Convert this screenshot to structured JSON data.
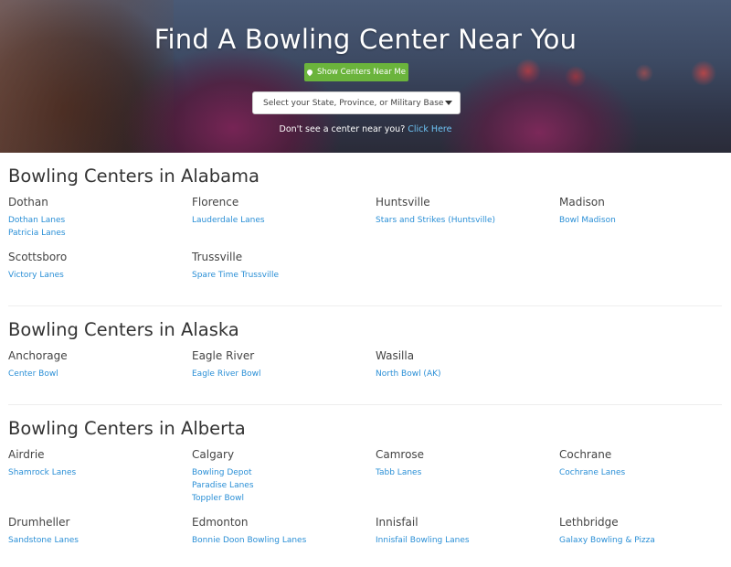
{
  "hero": {
    "title": "Find A Bowling Center Near You",
    "near_button": "Show Centers Near Me",
    "select_placeholder": "Select your State, Province, or Military Base",
    "note_text": "Don't see a center near you?",
    "note_link": "Click Here"
  },
  "sections": [
    {
      "title": "Bowling Centers in Alabama",
      "cities": [
        {
          "name": "Dothan",
          "centers": [
            "Dothan Lanes",
            "Patricia Lanes"
          ]
        },
        {
          "name": "Florence",
          "centers": [
            "Lauderdale Lanes"
          ]
        },
        {
          "name": "Huntsville",
          "centers": [
            "Stars and Strikes (Huntsville)"
          ]
        },
        {
          "name": "Madison",
          "centers": [
            "Bowl Madison"
          ]
        },
        {
          "name": "Scottsboro",
          "centers": [
            "Victory Lanes"
          ]
        },
        {
          "name": "Trussville",
          "centers": [
            "Spare Time Trussville"
          ]
        }
      ]
    },
    {
      "title": "Bowling Centers in Alaska",
      "cities": [
        {
          "name": "Anchorage",
          "centers": [
            "Center Bowl"
          ]
        },
        {
          "name": "Eagle River",
          "centers": [
            "Eagle River Bowl"
          ]
        },
        {
          "name": "Wasilla",
          "centers": [
            "North Bowl (AK)"
          ]
        }
      ]
    },
    {
      "title": "Bowling Centers in Alberta",
      "cities": [
        {
          "name": "Airdrie",
          "centers": [
            "Shamrock Lanes"
          ]
        },
        {
          "name": "Calgary",
          "centers": [
            "Bowling Depot",
            "Paradise Lanes",
            "Toppler Bowl"
          ]
        },
        {
          "name": "Camrose",
          "centers": [
            "Tabb Lanes"
          ]
        },
        {
          "name": "Cochrane",
          "centers": [
            "Cochrane Lanes"
          ]
        },
        {
          "name": "Drumheller",
          "centers": [
            "Sandstone Lanes"
          ]
        },
        {
          "name": "Edmonton",
          "centers": [
            "Bonnie Doon Bowling Lanes"
          ]
        },
        {
          "name": "Innisfail",
          "centers": [
            "Innisfail Bowling Lanes"
          ]
        },
        {
          "name": "Lethbridge",
          "centers": [
            "Galaxy Bowling & Pizza"
          ]
        }
      ]
    }
  ]
}
